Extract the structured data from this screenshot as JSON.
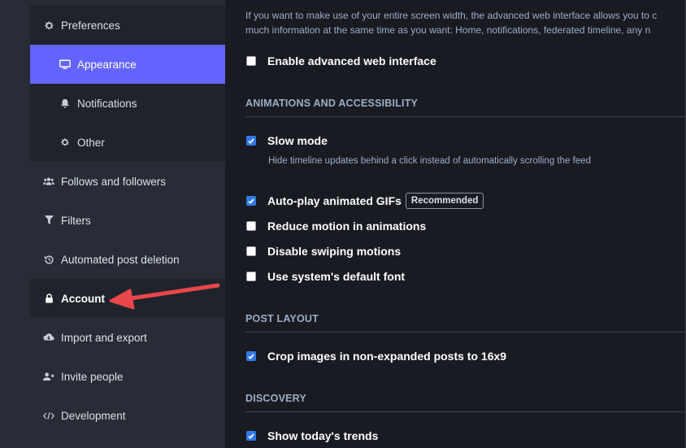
{
  "sidebar": {
    "preferences": "Preferences",
    "appearance": "Appearance",
    "notifications": "Notifications",
    "other": "Other",
    "follows": "Follows and followers",
    "filters": "Filters",
    "deletion": "Automated post deletion",
    "account": "Account",
    "import": "Import and export",
    "invite": "Invite people",
    "development": "Development"
  },
  "main": {
    "intro_line1": "If you want to make use of your entire screen width, the advanced web interface allows you to c",
    "intro_line2": "much information at the same time as you want: Home, notifications, federated timeline, any n",
    "advanced_label": "Enable advanced web interface",
    "animations": {
      "title": "ANIMATIONS AND ACCESSIBILITY",
      "slow_mode": "Slow mode",
      "slow_mode_hint": "Hide timeline updates behind a click instead of automatically scrolling the feed",
      "autoplay": "Auto-play animated GIFs",
      "recommended": "Recommended",
      "reduce_motion": "Reduce motion in animations",
      "disable_swipe": "Disable swiping motions",
      "system_font": "Use system's default font"
    },
    "post_layout": {
      "title": "POST LAYOUT",
      "crop": "Crop images in non-expanded posts to 16x9"
    },
    "discovery": {
      "title": "DISCOVERY",
      "trends": "Show today's trends"
    }
  },
  "colors": {
    "accent": "#6364ff",
    "checkbox": "#2f7ae6",
    "annotation_arrow": "#e8474b"
  }
}
